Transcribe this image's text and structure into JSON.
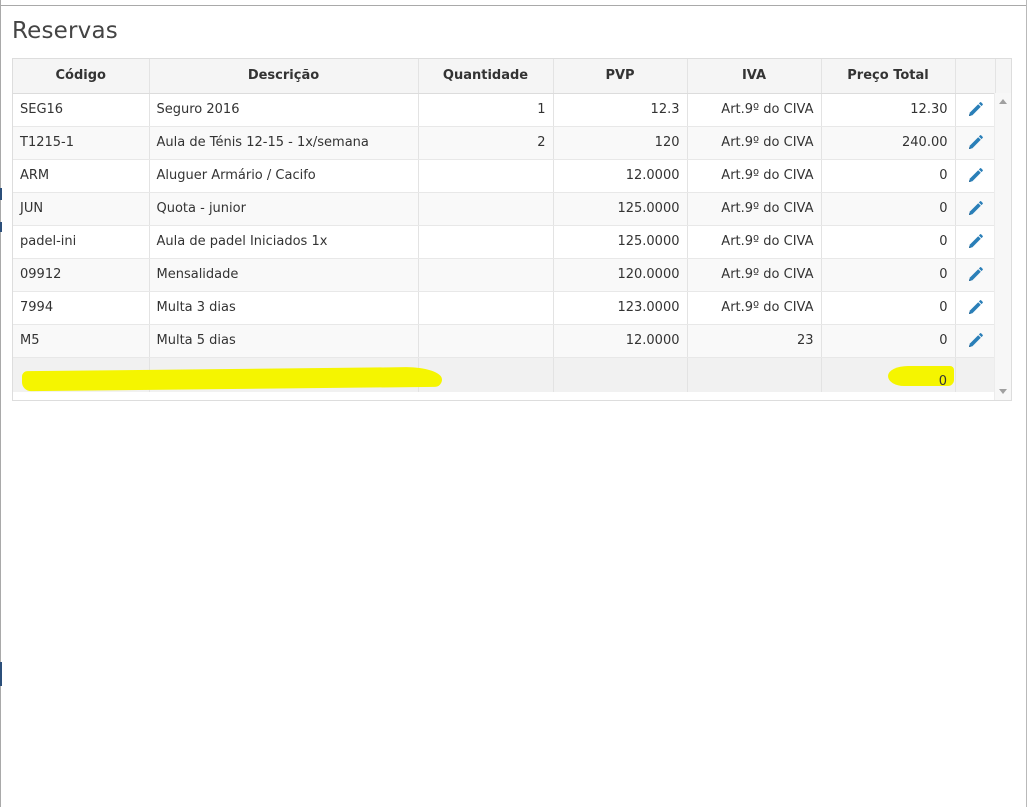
{
  "page": {
    "title": "Reservas"
  },
  "table": {
    "columns": [
      "Código",
      "Descrição",
      "Quantidade",
      "PVP",
      "IVA",
      "Preço Total"
    ],
    "rows": [
      {
        "codigo": "SEG16",
        "descricao": "Seguro 2016",
        "quantidade": "1",
        "pvp": "12.3",
        "iva": "Art.9º do CIVA",
        "total": "12.30"
      },
      {
        "codigo": "T1215-1",
        "descricao": "Aula de Ténis 12-15 - 1x/semana",
        "quantidade": "2",
        "pvp": "120",
        "iva": "Art.9º do CIVA",
        "total": "240.00"
      },
      {
        "codigo": "ARM",
        "descricao": "Aluguer Armário / Cacifo",
        "quantidade": "",
        "pvp": "12.0000",
        "iva": "Art.9º do CIVA",
        "total": "0"
      },
      {
        "codigo": "JUN",
        "descricao": "Quota - junior",
        "quantidade": "",
        "pvp": "125.0000",
        "iva": "Art.9º do CIVA",
        "total": "0"
      },
      {
        "codigo": "padel-ini",
        "descricao": "Aula de padel Iniciados 1x",
        "quantidade": "",
        "pvp": "125.0000",
        "iva": "Art.9º do CIVA",
        "total": "0"
      },
      {
        "codigo": "09912",
        "descricao": "Mensalidade",
        "quantidade": "",
        "pvp": "120.0000",
        "iva": "Art.9º do CIVA",
        "total": "0"
      },
      {
        "codigo": "7994",
        "descricao": "Multa 3 dias",
        "quantidade": "",
        "pvp": "123.0000",
        "iva": "Art.9º do CIVA",
        "total": "0"
      },
      {
        "codigo": "M5",
        "descricao": "Multa 5 dias",
        "quantidade": "",
        "pvp": "12.0000",
        "iva": "23",
        "total": "0"
      }
    ],
    "footer": {
      "total": "0"
    },
    "row_icon": "pencil-edit-icon"
  },
  "colors": {
    "accent_icon": "#2a7fb8",
    "highlight": "#f5f500",
    "header_bg": "#f5f5f5"
  }
}
